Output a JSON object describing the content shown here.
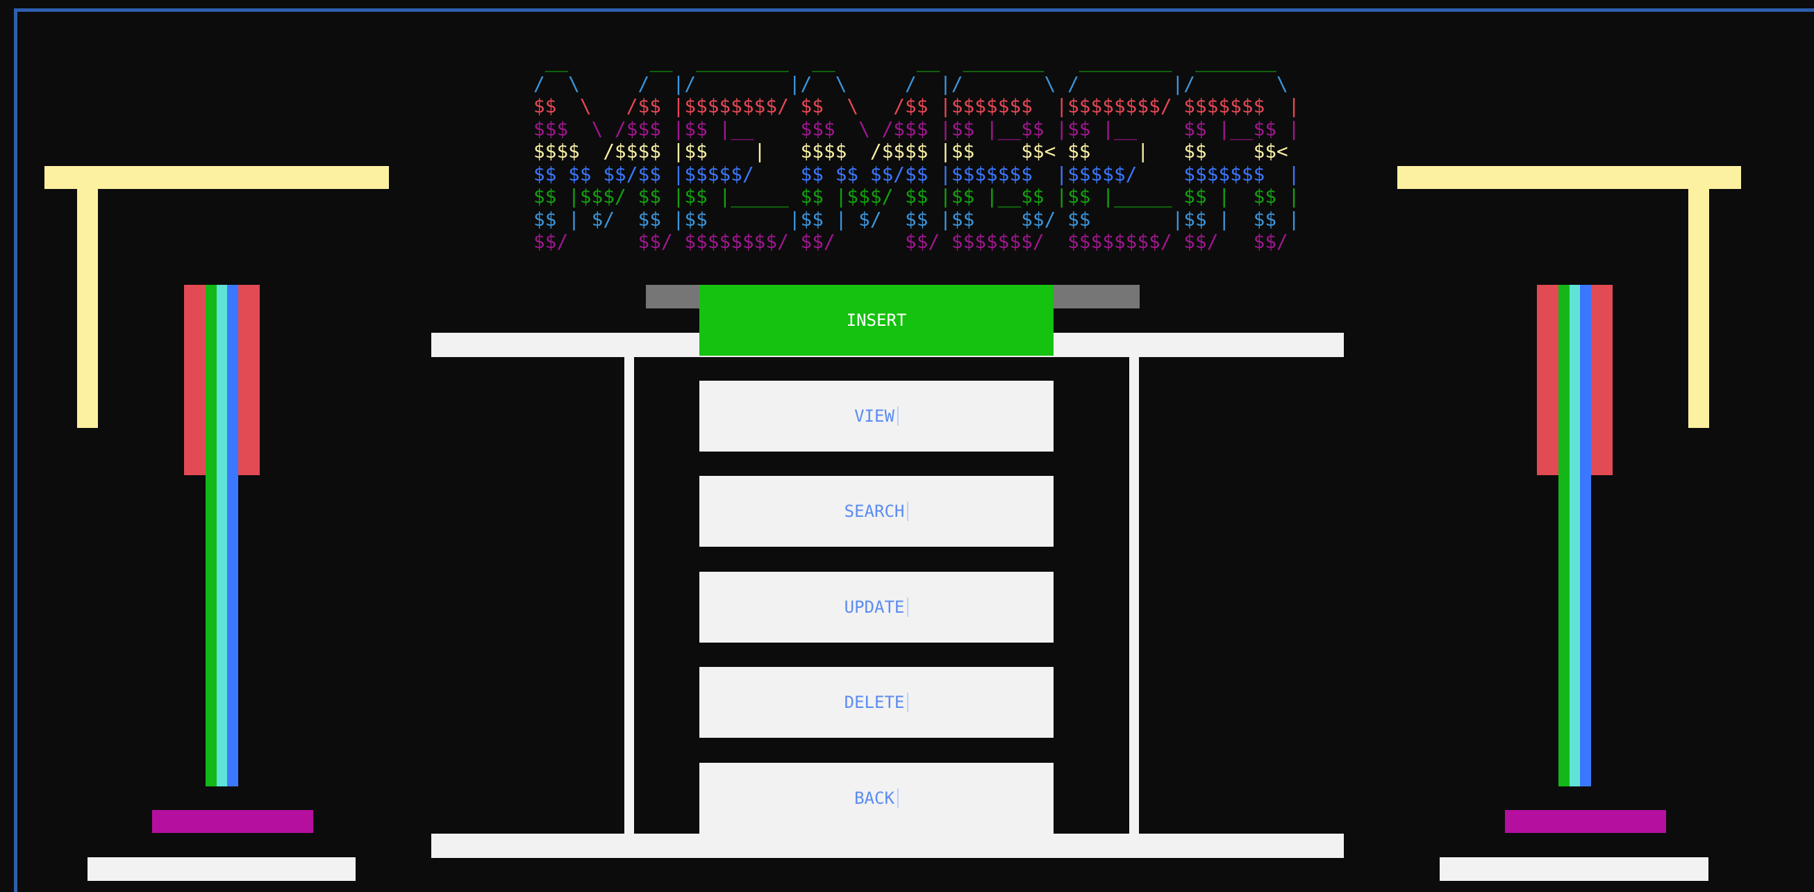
{
  "banner": {
    "lines": [
      {
        "text": " __       __  ________  __       __  _______   ________  _______  ",
        "color": "#13a10e"
      },
      {
        "text": "/  \\     /  |/        |/  \\     /  |/       \\ /        |/       \\ ",
        "color": "#3a96dd"
      },
      {
        "text": "$$  \\   /$$ |$$$$$$$$/ $$  \\   /$$ |$$$$$$$  |$$$$$$$$/ $$$$$$$  |",
        "color": "#e74856"
      },
      {
        "text": "$$$  \\ /$$$ |$$ |__    $$$  \\ /$$$ |$$ |__$$ |$$ |__    $$ |__$$ |",
        "color": "#a0178f"
      },
      {
        "text": "$$$$  /$$$$ |$$    |   $$$$  /$$$$ |$$    $$< $$    |   $$    $$< ",
        "color": "#f9f1a5"
      },
      {
        "text": "$$ $$ $$/$$ |$$$$$/    $$ $$ $$/$$ |$$$$$$$  |$$$$$/    $$$$$$$  |",
        "color": "#3b78ff"
      },
      {
        "text": "$$ |$$$/ $$ |$$ |_____ $$ |$$$/ $$ |$$ |__$$ |$$ |_____ $$ |  $$ |",
        "color": "#13a10e"
      },
      {
        "text": "$$ | $/  $$ |$$       |$$ | $/  $$ |$$    $$/ $$       |$$ |  $$ |",
        "color": "#3a96dd"
      },
      {
        "text": "$$/      $$/ $$$$$$$$/ $$/      $$/ $$$$$$$/  $$$$$$$$/ $$/   $$/ ",
        "color": "#a0178f"
      }
    ]
  },
  "menu": {
    "insert": "INSERT",
    "view": "VIEW",
    "search": "SEARCH",
    "update": "UPDATE",
    "delete": "DELETE",
    "back": "BACK"
  },
  "colors": {
    "background": "#0c0c0c",
    "frame": "#2f5fae",
    "insert_highlight": "#15c20f",
    "button_text": "#5b8cf0",
    "button_face": "#f2f2f2"
  }
}
